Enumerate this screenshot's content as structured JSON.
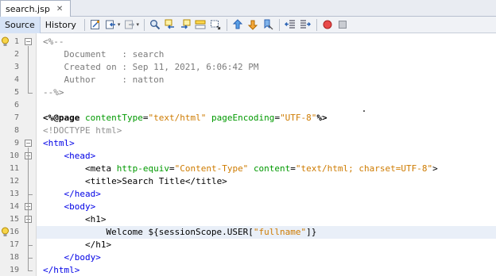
{
  "file_tab": {
    "label": "search.jsp",
    "close": "✕"
  },
  "toolbar": {
    "source_label": "Source",
    "history_label": "History",
    "dropdown_glyph": "▾"
  },
  "lines": [
    {
      "num": "1",
      "parts": [
        [
          "c-comment",
          "<%--"
        ]
      ]
    },
    {
      "num": "2",
      "parts": [
        [
          "c-comment",
          "    Document   : search"
        ]
      ]
    },
    {
      "num": "3",
      "parts": [
        [
          "c-comment",
          "    Created on : Sep 11, 2021, 6:06:42 PM"
        ]
      ]
    },
    {
      "num": "4",
      "parts": [
        [
          "c-comment",
          "    Author     : natton"
        ]
      ]
    },
    {
      "num": "5",
      "parts": [
        [
          "c-comment",
          "--%>"
        ]
      ]
    },
    {
      "num": "6",
      "parts": []
    },
    {
      "num": "7",
      "parts": [
        [
          "c-dir",
          "<%@page "
        ],
        [
          "c-attr",
          "contentType"
        ],
        [
          "c-text",
          "="
        ],
        [
          "c-val",
          "\"text/html\""
        ],
        [
          "c-text",
          " "
        ],
        [
          "c-attr",
          "pageEncoding"
        ],
        [
          "c-text",
          "="
        ],
        [
          "c-val",
          "\"UTF-8\""
        ],
        [
          "c-dir",
          "%>"
        ]
      ]
    },
    {
      "num": "8",
      "parts": [
        [
          "c-doctype",
          "<!DOCTYPE html>"
        ]
      ]
    },
    {
      "num": "9",
      "parts": [
        [
          "c-tag",
          "<html>"
        ]
      ]
    },
    {
      "num": "10",
      "parts": [
        [
          "c-text",
          "    "
        ],
        [
          "c-tag",
          "<head>"
        ]
      ]
    },
    {
      "num": "11",
      "parts": [
        [
          "c-text",
          "        "
        ],
        [
          "c-el",
          "<meta "
        ],
        [
          "c-attr",
          "http-equiv"
        ],
        [
          "c-text",
          "="
        ],
        [
          "c-val",
          "\"Content-Type\""
        ],
        [
          "c-text",
          " "
        ],
        [
          "c-attr",
          "content"
        ],
        [
          "c-text",
          "="
        ],
        [
          "c-val",
          "\"text/html; charset=UTF-8\""
        ],
        [
          "c-el",
          ">"
        ]
      ]
    },
    {
      "num": "12",
      "parts": [
        [
          "c-text",
          "        "
        ],
        [
          "c-el",
          "<title>"
        ],
        [
          "c-text",
          "Search Title"
        ],
        [
          "c-el",
          "</title>"
        ]
      ]
    },
    {
      "num": "13",
      "parts": [
        [
          "c-text",
          "    "
        ],
        [
          "c-tag",
          "</head>"
        ]
      ]
    },
    {
      "num": "14",
      "parts": [
        [
          "c-text",
          "    "
        ],
        [
          "c-tag",
          "<body>"
        ]
      ]
    },
    {
      "num": "15",
      "parts": [
        [
          "c-text",
          "        "
        ],
        [
          "c-el",
          "<h1>"
        ]
      ]
    },
    {
      "num": "16",
      "parts": [
        [
          "c-text",
          "            Welcome ${sessionScope.USER["
        ],
        [
          "c-val",
          "\"fullname\""
        ],
        [
          "c-text",
          "]}"
        ]
      ]
    },
    {
      "num": "17",
      "parts": [
        [
          "c-text",
          "        "
        ],
        [
          "c-el",
          "</h1>"
        ]
      ]
    },
    {
      "num": "18",
      "parts": [
        [
          "c-text",
          "    "
        ],
        [
          "c-tag",
          "</body>"
        ]
      ]
    },
    {
      "num": "19",
      "parts": [
        [
          "c-tag",
          "</html>"
        ]
      ]
    }
  ],
  "colors": {
    "comment": "#7b7b7b",
    "tag": "#0000e6",
    "attribute": "#009900",
    "value": "#ce7b00",
    "current_line": "#e9eff8"
  },
  "icons": [
    "last-edit-icon",
    "back-icon",
    "forward-icon",
    "find-selection-icon",
    "find-previous-icon",
    "find-next-icon",
    "toggle-highlight-icon",
    "toggle-rectangular-selection-icon",
    "previous-bookmark-icon",
    "next-bookmark-icon",
    "toggle-bookmark-icon",
    "shift-line-left-icon",
    "shift-line-right-icon",
    "start-macro-recording-icon",
    "stop-macro-recording-icon"
  ]
}
